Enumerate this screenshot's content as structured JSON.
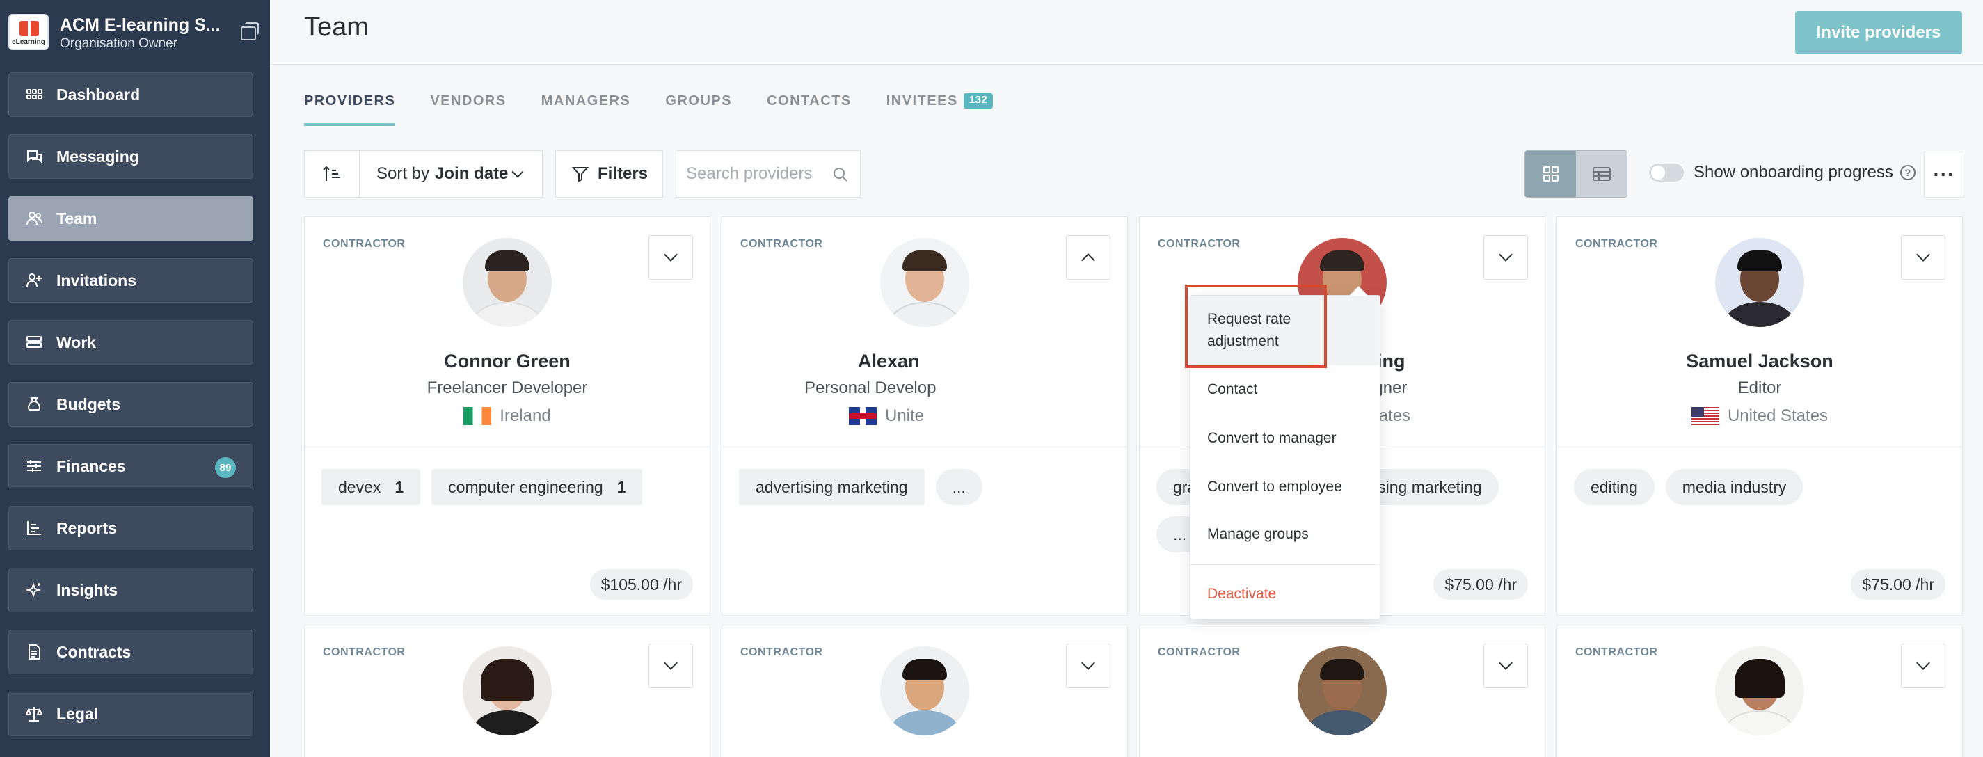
{
  "org": {
    "name": "ACM E-learning S...",
    "role": "Organisation Owner",
    "logo_text": "eLearning"
  },
  "sidebar": {
    "items": [
      {
        "label": "Dashboard",
        "icon": "grid-icon"
      },
      {
        "label": "Messaging",
        "icon": "chat-icon"
      },
      {
        "label": "Team",
        "icon": "users-icon",
        "active": true
      },
      {
        "label": "Invitations",
        "icon": "user-plus-icon"
      },
      {
        "label": "Work",
        "icon": "work-icon"
      },
      {
        "label": "Budgets",
        "icon": "money-bag-icon"
      },
      {
        "label": "Finances",
        "icon": "sliders-icon",
        "badge": "89"
      },
      {
        "label": "Reports",
        "icon": "bar-chart-icon"
      },
      {
        "label": "Insights",
        "icon": "sparkle-icon"
      },
      {
        "label": "Contracts",
        "icon": "document-icon"
      },
      {
        "label": "Legal",
        "icon": "scales-icon"
      }
    ]
  },
  "header": {
    "title": "Team",
    "invite_label": "Invite providers"
  },
  "tabs": [
    {
      "label": "PROVIDERS",
      "active": true
    },
    {
      "label": "VENDORS"
    },
    {
      "label": "MANAGERS"
    },
    {
      "label": "GROUPS"
    },
    {
      "label": "CONTACTS"
    },
    {
      "label": "INVITEES",
      "count": "132"
    }
  ],
  "toolbar": {
    "sort_prefix": "Sort by",
    "sort_value": "Join date",
    "filters_label": "Filters",
    "search_placeholder": "Search providers",
    "onboarding_label": "Show onboarding progress",
    "more_label": "···"
  },
  "cards": [
    {
      "type": "CONTRACTOR",
      "name": "Connor Green",
      "role": "Freelancer Developer",
      "country": "Ireland",
      "flag": "ie",
      "tags": [
        {
          "label": "devex",
          "count": "1"
        },
        {
          "label": "computer engineering",
          "count": "1"
        }
      ],
      "rate": "$105.00 /hr"
    },
    {
      "type": "CONTRACTOR",
      "name": "Alexan",
      "role": "Personal Develop",
      "country": "Unite",
      "flag": "uk",
      "tags": [
        {
          "label": "advertising marketing"
        },
        {
          "label": "..."
        }
      ],
      "rate": ""
    },
    {
      "type": "CONTRACTOR",
      "name": "Tyler Manning",
      "role": "Graphic Designer",
      "country": "United States",
      "flag": "us",
      "tags": [
        {
          "label": "graphics design"
        },
        {
          "label": "advertising marketing"
        },
        {
          "label": "..."
        }
      ],
      "rate": "$75.00 /hr"
    },
    {
      "type": "CONTRACTOR",
      "name": "Samuel Jackson",
      "role": "Editor",
      "country": "United States",
      "flag": "us",
      "tags": [
        {
          "label": "editing"
        },
        {
          "label": "media industry"
        }
      ],
      "rate": "$75.00 /hr"
    }
  ],
  "bottom_cards": [
    {
      "type": "CONTRACTOR"
    },
    {
      "type": "CONTRACTOR"
    },
    {
      "type": "CONTRACTOR"
    },
    {
      "type": "CONTRACTOR"
    }
  ],
  "menu": {
    "items": [
      {
        "label": "Request rate adjustment"
      },
      {
        "label": "Contact"
      },
      {
        "label": "Convert to manager"
      },
      {
        "label": "Convert to employee"
      },
      {
        "label": "Manage groups"
      },
      {
        "label": "Deactivate"
      }
    ]
  },
  "colors": {
    "sidebar": "#2c3a4f",
    "accent": "#7dc3c9",
    "badge": "#5bb7bf",
    "danger": "#e05a45",
    "highlight_box": "#d9472f"
  }
}
